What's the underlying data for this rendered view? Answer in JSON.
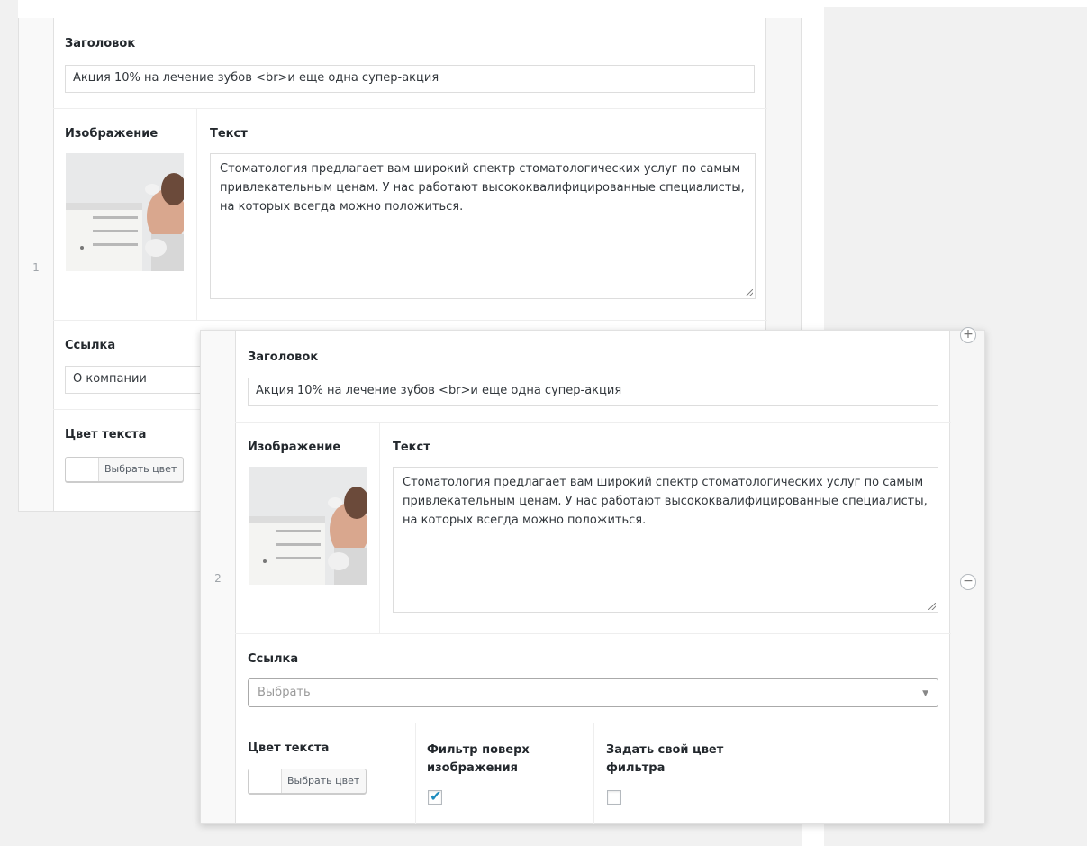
{
  "rows": [
    {
      "number": "1",
      "title_label": "Заголовок",
      "title_value": "Акция 10% на лечение зубов <br>и еще одна супер-акция",
      "image_label": "Изображение",
      "text_label": "Текст",
      "text_value": "Стоматология предлагает вам широкий спектр стоматологических услуг по самым привлекательным ценам. У нас работают высококвалифицированные специалисты, на которых всегда можно положиться.",
      "link_label": "Ссылка",
      "link_value": "О компании",
      "color_label": "Цвет текста",
      "color_button": "Выбрать цвет"
    },
    {
      "number": "2",
      "title_label": "Заголовок",
      "title_value": "Акция 10% на лечение зубов <br>и еще одна супер-акция",
      "image_label": "Изображение",
      "text_label": "Текст",
      "text_value": "Стоматология предлагает вам широкий спектр стоматологических услуг по самым привлекательным ценам. У нас работают высококвалифицированные специалисты, на которых всегда можно положиться.",
      "link_label": "Ссылка",
      "link_placeholder": "Выбрать",
      "color_label": "Цвет текста",
      "color_button": "Выбрать цвет",
      "filter_label": "Фильтр поверх изображения",
      "filter_checked": true,
      "custom_filter_label": "Задать свой цвет фильтра",
      "custom_filter_checked": false
    }
  ],
  "controls": {
    "add_icon": "plus-circle",
    "remove_icon": "minus-circle"
  },
  "colors": {
    "accent": "#1e8cbe",
    "border": "#dddddd",
    "background": "#f1f1f1"
  }
}
